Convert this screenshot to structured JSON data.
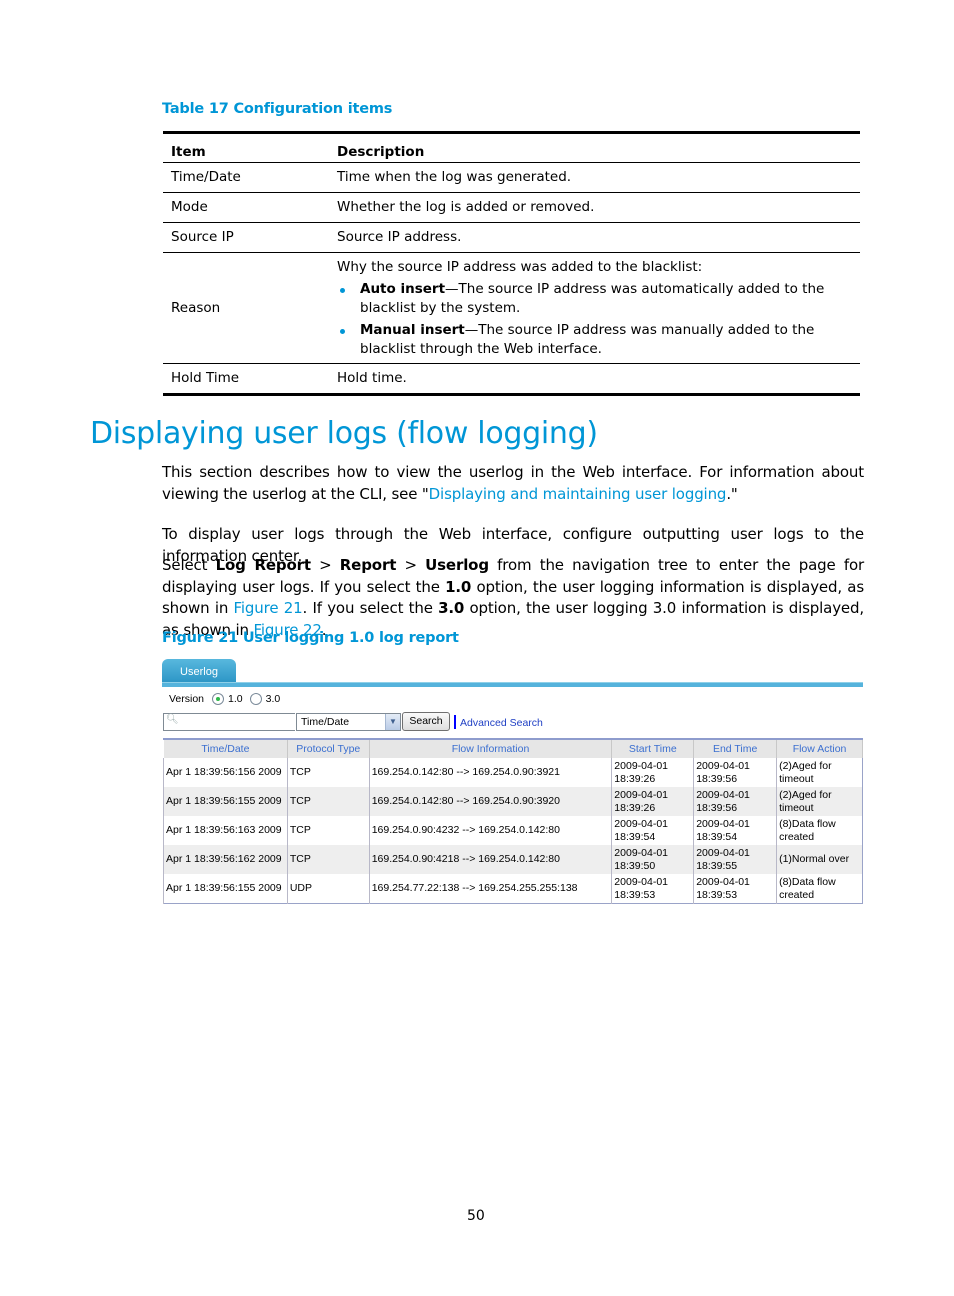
{
  "table17": {
    "caption": "Table 17 Configuration items",
    "headers": {
      "item": "Item",
      "description": "Description"
    },
    "rows": [
      {
        "item": "Time/Date",
        "description": "Time when the log was generated."
      },
      {
        "item": "Mode",
        "description": "Whether the log is added or removed."
      },
      {
        "item": "Source IP",
        "description": "Source IP address."
      },
      {
        "item": "Reason",
        "intro": "Why the source IP address was added to the blacklist:",
        "bullets": [
          {
            "term": "Auto insert",
            "text": "—The source IP address was automatically added to the blacklist by the system."
          },
          {
            "term": "Manual insert",
            "text": "—The source IP address was manually added to the blacklist through the Web interface."
          }
        ]
      },
      {
        "item": "Hold Time",
        "description": "Hold time."
      }
    ]
  },
  "section": {
    "title": "Displaying user logs (flow logging)",
    "p1": {
      "text_before": "This section describes how to view the userlog in the Web interface. For information about viewing the userlog at the CLI, see \"",
      "link": "Displaying and maintaining user logging",
      "text_after": ".\""
    },
    "p2": "To display user logs through the Web interface, configure outputting user logs to the information center.",
    "p3": {
      "t1": "Select ",
      "b1": "Log Report",
      "t2": " > ",
      "b2": "Report",
      "t3": " > ",
      "b3": "Userlog",
      "t4": " from the navigation tree to enter the page for displaying user logs. If you select the ",
      "b4": "1.0",
      "t5": " option, the user logging information is displayed, as shown in ",
      "link1": "Figure 21",
      "t6": ". If you select the ",
      "b5": "3.0",
      "t7": " option, the user logging 3.0 information is displayed, as shown in ",
      "link2": "Figure 22",
      "t8": "."
    },
    "figure_caption": "Figure 21 User logging 1.0 log report"
  },
  "figure": {
    "tab_label": "Userlog",
    "version_label": "Version",
    "version_options": [
      "1.0",
      "3.0"
    ],
    "version_selected": "1.0",
    "search_value": "",
    "field_select_value": "Time/Date",
    "search_button": "Search",
    "advanced_search": "Advanced Search",
    "columns": [
      "Time/Date",
      "Protocol Type",
      "Flow Information",
      "Start Time",
      "End Time",
      "Flow Action"
    ],
    "rows": [
      {
        "time": "Apr 1 18:39:56:156 2009",
        "proto": "TCP",
        "flow": "169.254.0.142:80 --> 169.254.0.90:3921",
        "start_date": "2009-04-01",
        "start_time": "18:39:26",
        "end_date": "2009-04-01",
        "end_time": "18:39:56",
        "action1": "(2)Aged for",
        "action2": "timeout"
      },
      {
        "time": "Apr 1 18:39:56:155 2009",
        "proto": "TCP",
        "flow": "169.254.0.142:80 --> 169.254.0.90:3920",
        "start_date": "2009-04-01",
        "start_time": "18:39:26",
        "end_date": "2009-04-01",
        "end_time": "18:39:56",
        "action1": "(2)Aged for",
        "action2": "timeout"
      },
      {
        "time": "Apr 1 18:39:56:163 2009",
        "proto": "TCP",
        "flow": "169.254.0.90:4232 --> 169.254.0.142:80",
        "start_date": "2009-04-01",
        "start_time": "18:39:54",
        "end_date": "2009-04-01",
        "end_time": "18:39:54",
        "action1": "(8)Data flow",
        "action2": "created"
      },
      {
        "time": "Apr 1 18:39:56:162 2009",
        "proto": "TCP",
        "flow": "169.254.0.90:4218 --> 169.254.0.142:80",
        "start_date": "2009-04-01",
        "start_time": "18:39:50",
        "end_date": "2009-04-01",
        "end_time": "18:39:55",
        "action1": "(1)Normal over",
        "action2": ""
      },
      {
        "time": "Apr 1 18:39:56:155 2009",
        "proto": "UDP",
        "flow": "169.254.77.22:138 --> 169.254.255.255:138",
        "start_date": "2009-04-01",
        "start_time": "18:39:53",
        "end_date": "2009-04-01",
        "end_time": "18:39:53",
        "action1": "(8)Data flow",
        "action2": "created"
      }
    ]
  },
  "page_number": "50"
}
